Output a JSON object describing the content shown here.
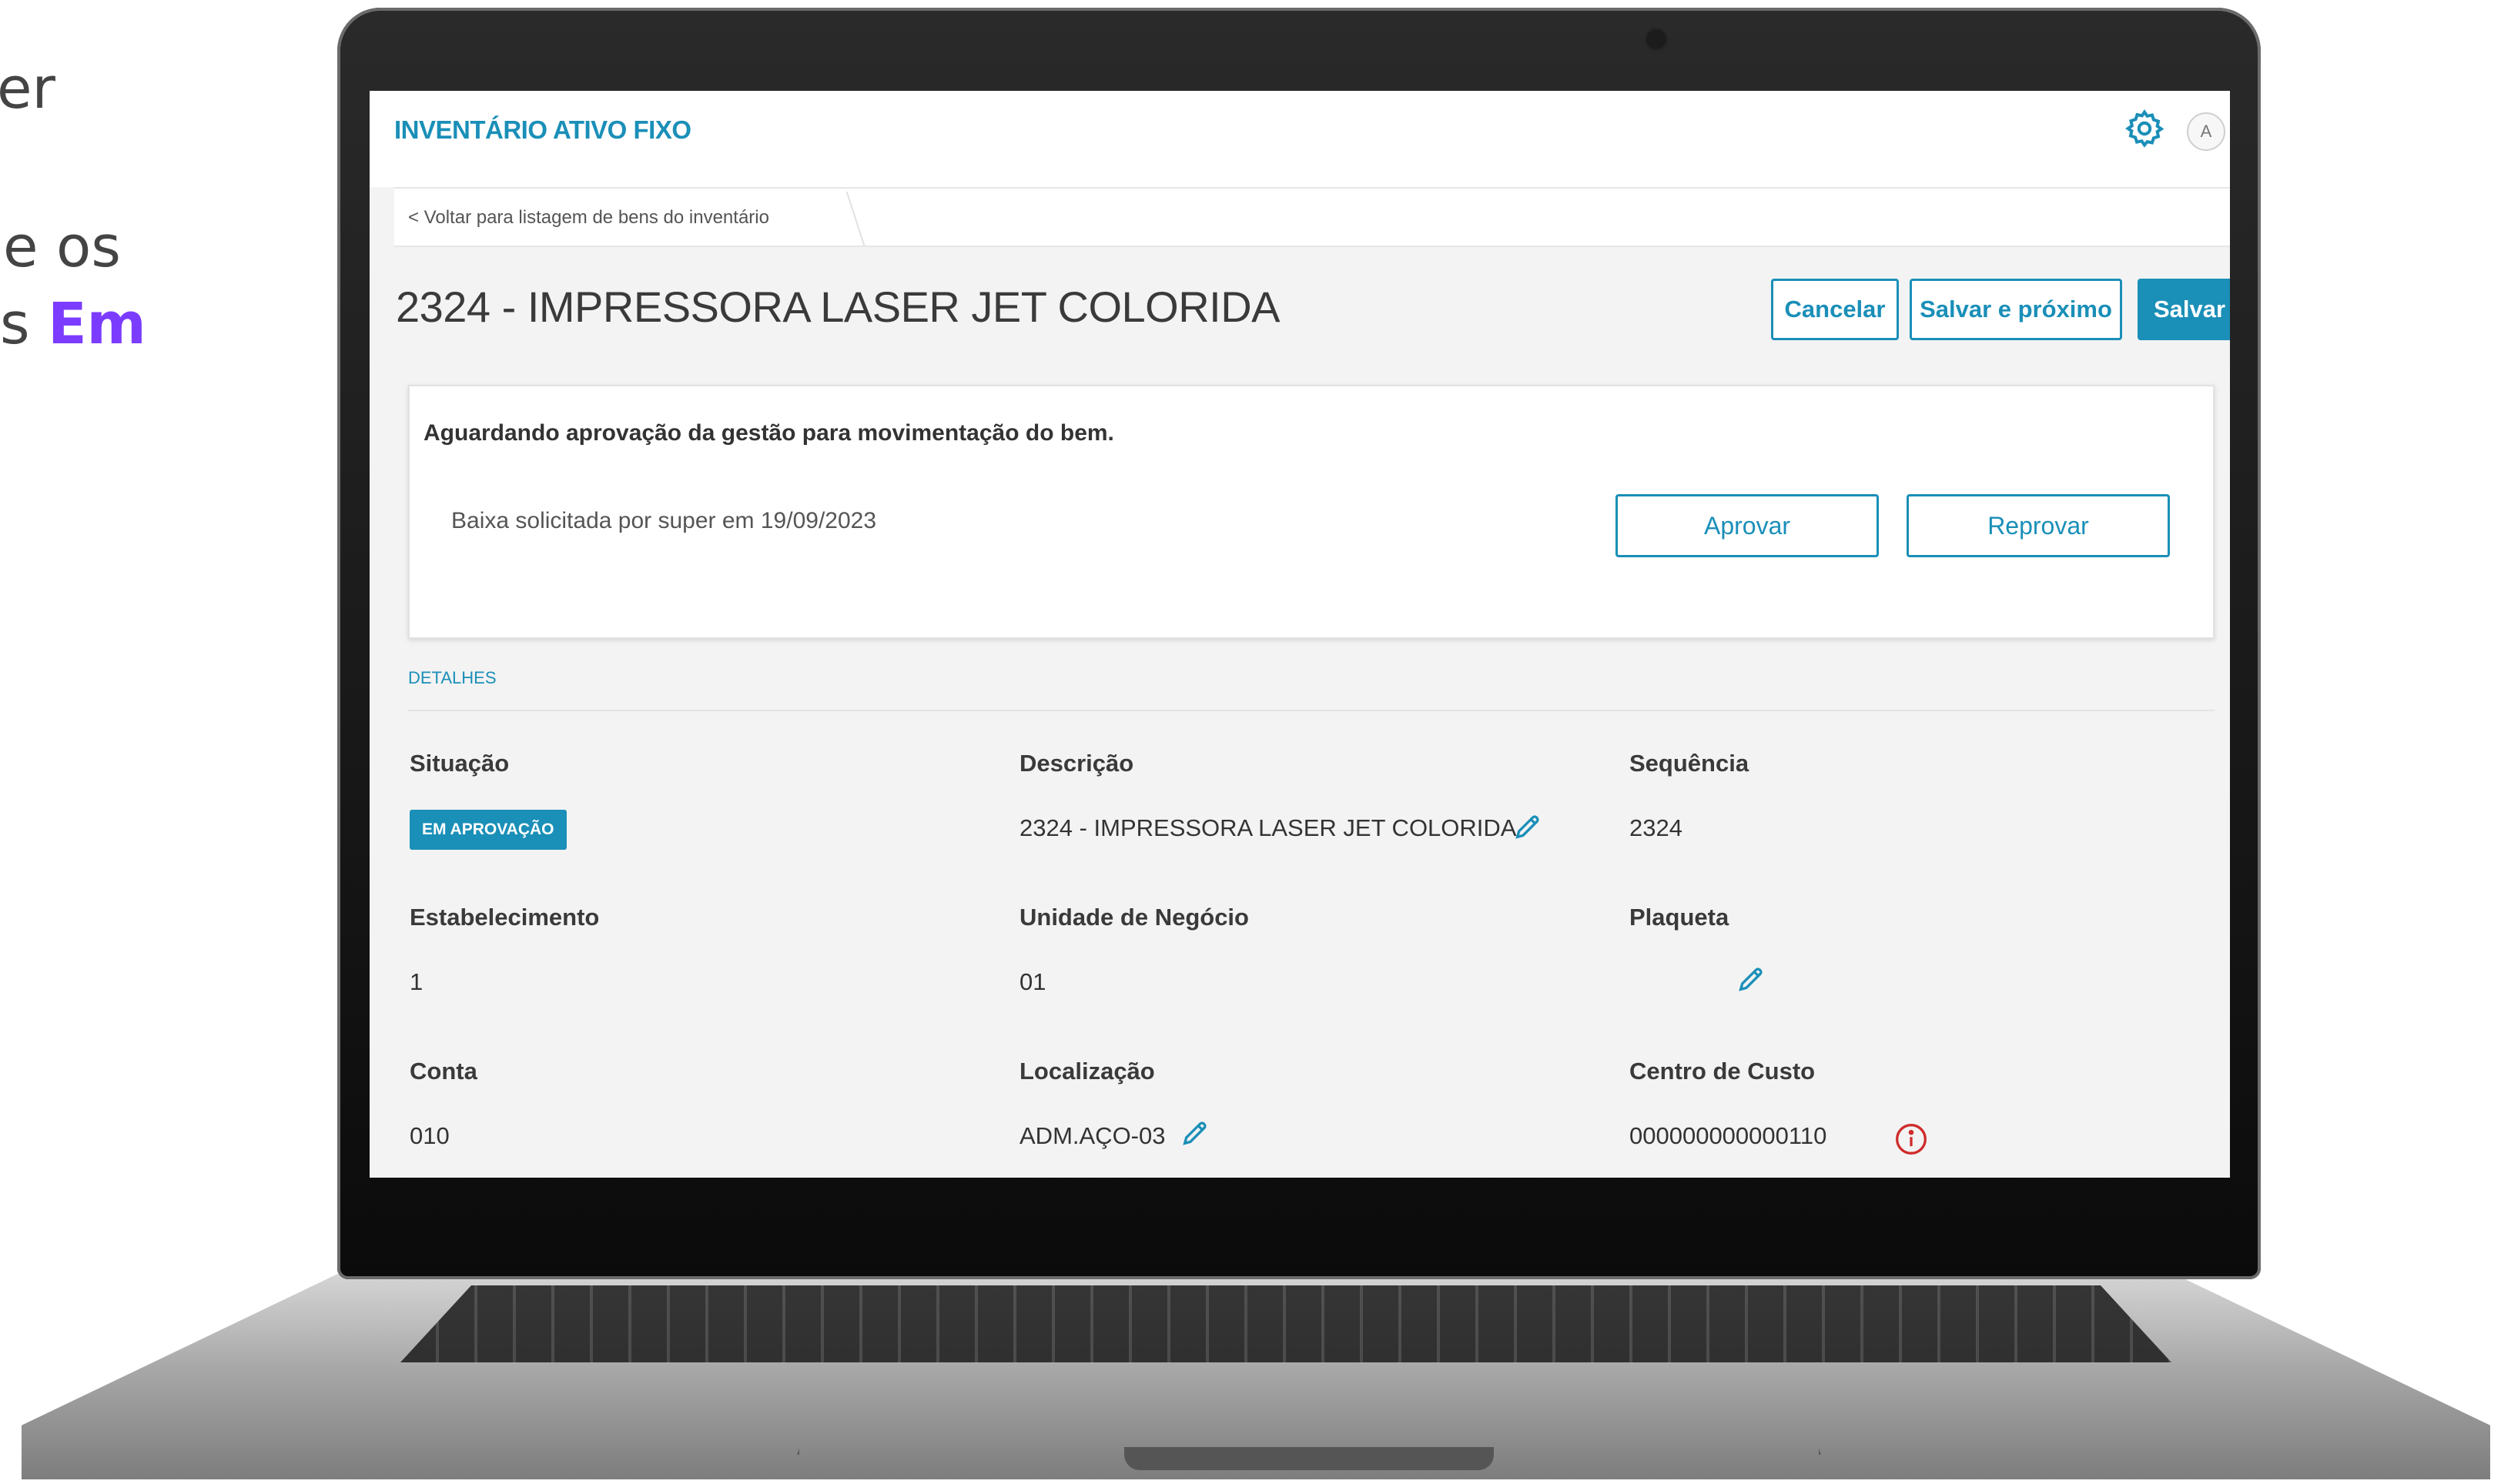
{
  "slide_text": {
    "line1": "er",
    "line2": "e os",
    "line3_prefix": "s ",
    "line3_highlight": "Em",
    "highlight_color": "#7b3cff"
  },
  "app": {
    "title": "INVENTÁRIO ATIVO FIXO",
    "accent_color": "#1a8fb8",
    "settings_icon": "gear-icon",
    "avatar_letter": "A"
  },
  "breadcrumb": {
    "back_label": "< Voltar para listagem de bens do inventário"
  },
  "page": {
    "title": "2324 - IMPRESSORA LASER JET COLORIDA"
  },
  "actions": {
    "cancel_label": "Cancelar",
    "save_next_label": "Salvar e próximo",
    "save_label": "Salvar"
  },
  "approval": {
    "message": "Aguardando aprovação da gestão para movimentação do bem.",
    "note": "Baixa solicitada por super em 19/09/2023",
    "approve_label": "Aprovar",
    "reject_label": "Reprovar"
  },
  "details": {
    "section_title": "DETALHES",
    "situacao": {
      "label": "Situação",
      "value": "EM APROVAÇÃO",
      "status_color": "#1a8fb8"
    },
    "descricao": {
      "label": "Descrição",
      "value": "2324 - IMPRESSORA LASER JET COLORIDA"
    },
    "sequencia": {
      "label": "Sequência",
      "value": "2324"
    },
    "estabelecimento": {
      "label": "Estabelecimento",
      "value": "1"
    },
    "unidade_negocio": {
      "label": "Unidade de Negócio",
      "value": "01"
    },
    "plaqueta": {
      "label": "Plaqueta",
      "value": ""
    },
    "conta": {
      "label": "Conta",
      "value": "010"
    },
    "localizacao": {
      "label": "Localização",
      "value": "ADM.AÇO-03"
    },
    "centro_custo": {
      "label": "Centro de Custo",
      "value": "000000000000110",
      "warning_color": "#d02b2b"
    }
  }
}
